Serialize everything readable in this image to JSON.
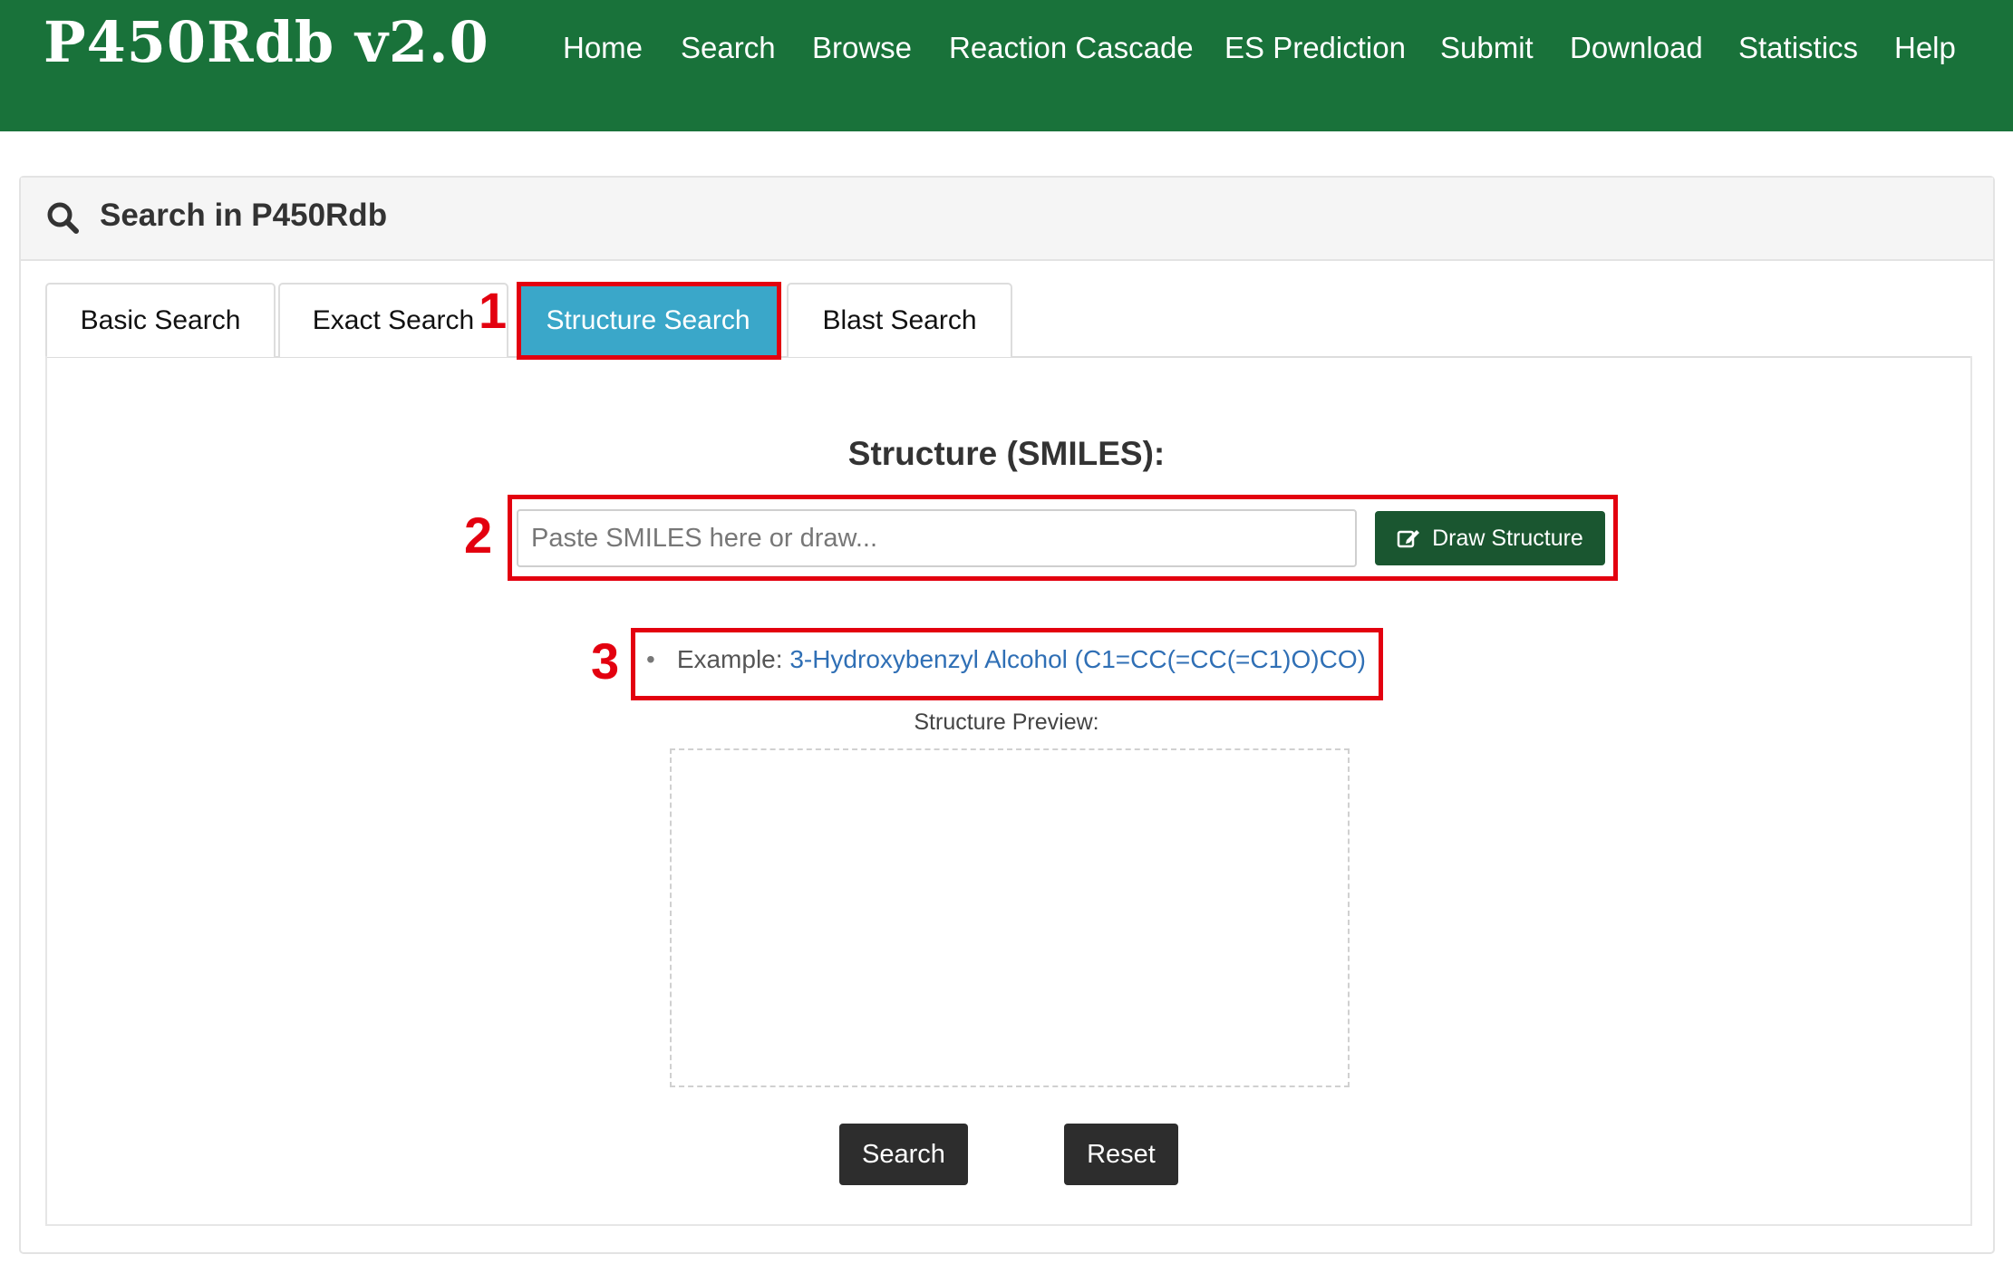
{
  "app": {
    "brand": "P450Rdb v2.0"
  },
  "nav": {
    "items": [
      "Home",
      "Search",
      "Browse",
      "Reaction Cascade",
      "ES Prediction",
      "Submit",
      "Download",
      "Statistics",
      "Help"
    ]
  },
  "panel": {
    "title": "Search in P450Rdb"
  },
  "tabs": [
    {
      "label": "Basic Search",
      "active": false
    },
    {
      "label": "Exact Search",
      "active": false
    },
    {
      "label": "Structure Search",
      "active": true
    },
    {
      "label": "Blast Search",
      "active": false
    }
  ],
  "form": {
    "label": "Structure (SMILES):",
    "input_placeholder": "Paste SMILES here or draw...",
    "input_value": "",
    "draw_button": "Draw Structure",
    "example_prefix": "Example:",
    "example_link": "3-Hydroxybenzyl Alcohol (C1=CC(=CC(=C1)O)CO)",
    "preview_label": "Structure Preview:",
    "search_button": "Search",
    "reset_button": "Reset"
  },
  "annotations": [
    "1",
    "2",
    "3"
  ],
  "colors": {
    "header_bg": "#19723a",
    "active_tab": "#3aa7c9",
    "draw_button": "#1a5630",
    "annotation": "#e3000f",
    "link": "#2f6fb5"
  },
  "icons": {
    "panel_icon": "search-icon",
    "draw_icon": "edit-icon"
  }
}
